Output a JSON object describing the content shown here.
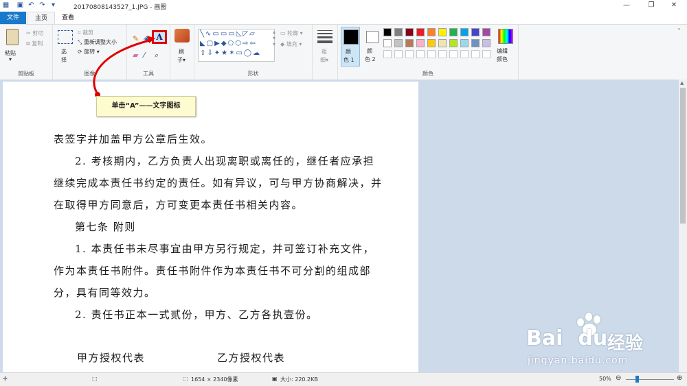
{
  "window": {
    "title": "20170808143527_1.JPG - 画图",
    "minimize_glyph": "—",
    "restore_glyph": "❐",
    "close_glyph": "✕"
  },
  "quick_access": {
    "save_icon": "save-icon",
    "undo_icon": "undo-icon",
    "redo_icon": "redo-icon"
  },
  "tabs": {
    "file": "文件",
    "home": "主页",
    "view": "查看"
  },
  "ribbon": {
    "clipboard": {
      "paste": "粘贴",
      "cut": "剪切",
      "copy": "复制",
      "label": "剪贴板"
    },
    "image": {
      "select": "选",
      "select2": "择",
      "crop": "裁剪",
      "resize": "重新调整大小",
      "rotate": "旋转",
      "label": "图像"
    },
    "tools": {
      "label": "工具",
      "text_tool": "A"
    },
    "brushes": {
      "label1": "刷",
      "label2": "子"
    },
    "shapes": {
      "outline": "轮廓",
      "fill": "填充",
      "label": "形状"
    },
    "size": {
      "label1": "粗",
      "label2": "细"
    },
    "colors": {
      "color1": "颜",
      "color1b": "色 1",
      "color2": "颜",
      "color2b": "色 2",
      "edit": "编辑",
      "edit2": "颜色",
      "label": "颜色",
      "palette_row1": [
        "#000000",
        "#7f7f7f",
        "#880015",
        "#ed1c24",
        "#ff7f27",
        "#fff200",
        "#22b14c",
        "#00a2e8",
        "#3f48cc",
        "#a349a4"
      ],
      "palette_row2": [
        "#ffffff",
        "#c3c3c3",
        "#b97a57",
        "#ffaec9",
        "#ffc90e",
        "#efe4b0",
        "#b5e61d",
        "#99d9ea",
        "#7092be",
        "#c8bfe7"
      ]
    }
  },
  "callout": {
    "text": "单击“A”——文字图标"
  },
  "document": {
    "line1": "表签字并加盖甲方公章后生效。",
    "line2": "2. 考核期内，乙方负责人出现离职或离任的，继任者应承担",
    "line3": "继续完成本责任书约定的责任。如有异议，可与甲方协商解决，并",
    "line4": "在取得甲方同意后，方可变更本责任书相关内容。",
    "line5": "第七条  附则",
    "line6": "1. 本责任书未尽事宜由甲方另行规定，并可签订补充文件，",
    "line7": "作为本责任书附件。责任书附件作为本责任书不可分割的组成部",
    "line8": "分，具有同等效力。",
    "line9": "2. 责任书正本一式贰份，甲方、乙方各执壹份。",
    "sign_a": "甲方授权代表",
    "sign_b": "乙方授权代表"
  },
  "statusbar": {
    "dimensions": "1654 × 2340像素",
    "size": "大小: 220.2KB",
    "zoom": "50%"
  },
  "watermark": {
    "brand": "Bai",
    "brand2": "du",
    "cn": "经验",
    "url": "jingyan.baidu.com"
  },
  "accent": "#1979ca",
  "highlight": "#e00000"
}
